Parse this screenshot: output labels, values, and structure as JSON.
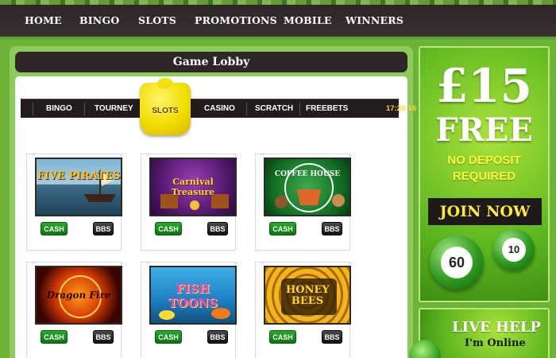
{
  "nav": {
    "items": [
      "HOME",
      "BINGO",
      "SLOTS",
      "PROMOTIONS",
      "MOBILE",
      "WINNERS"
    ]
  },
  "lobby": {
    "title": "Game Lobby",
    "tabs": [
      "BINGO",
      "TOURNEY",
      "SLOTS",
      "CASINO",
      "SCRATCH",
      "FREEBETS"
    ],
    "active_tab": "SLOTS",
    "clock": "17:20:16",
    "cash_label": "CASH",
    "bbs_label": "BBS",
    "games": [
      {
        "thumb_text": "FIVE PIRATES",
        "icon": "pirate-ship-icon"
      },
      {
        "thumb_text": "Carnival Treasure",
        "icon": "treasure-icon"
      },
      {
        "thumb_text": "COFFEE HOUSE",
        "icon": "coffee-cup-icon"
      },
      {
        "thumb_text": "Dragon Fire",
        "icon": "dragon-icon"
      },
      {
        "thumb_text": "FISH TOONS",
        "icon": "fish-icon"
      },
      {
        "thumb_text": "HONEY BEES",
        "icon": "bee-icon"
      }
    ]
  },
  "promo": {
    "amount": "£15",
    "free": "FREE",
    "no_deposit_line1": "NO DEPOSIT",
    "no_deposit_line2": "REQUIRED",
    "join": "JOIN NOW",
    "ball_1": "60",
    "ball_2": "10"
  },
  "live_help": {
    "title": "LIVE HELP",
    "status": "I'm Online"
  },
  "colors": {
    "page_green": "#6fb23a",
    "nav_dark": "#2a2324",
    "cash_green": "#0a7410",
    "promo_yellow": "#fff53a"
  }
}
